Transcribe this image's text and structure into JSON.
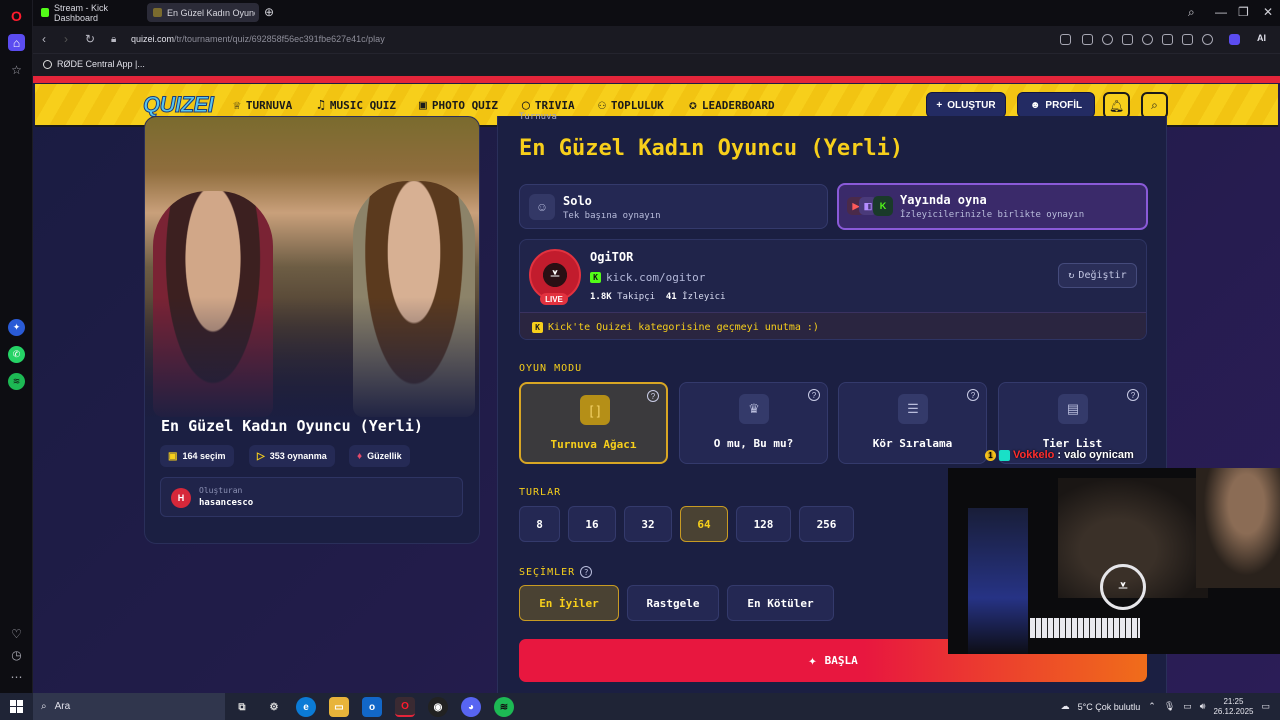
{
  "browser": {
    "tabs": [
      {
        "label": "Stream - Kick Dashboard",
        "favicon_color": "#53fc18"
      },
      {
        "label": "En Güzel Kadın Oyuncu (Y",
        "favicon_color": "#7a6b2e"
      }
    ],
    "url_host": "quizei.com",
    "url_path": "/tr/tournament/quiz/692858f56ec391fbe627e41c/play",
    "ai_label": "AI",
    "bookmark": "RØDE Central App |..."
  },
  "site": {
    "logo": "QUIZEI",
    "nav": [
      {
        "label": "TURNUVA",
        "icon": "trophy-icon"
      },
      {
        "label": "MUSIC QUIZ",
        "icon": "music-note-icon"
      },
      {
        "label": "PHOTO QUIZ",
        "icon": "camera-icon"
      },
      {
        "label": "TRIVIA",
        "icon": "chat-bubble-icon"
      },
      {
        "label": "TOPLULUK",
        "icon": "users-icon"
      },
      {
        "label": "LEADERBOARD",
        "icon": "medal-icon"
      }
    ],
    "create_btn": "OLUŞTUR",
    "profile_btn": "PROFİL",
    "accent": "#f7cf1b",
    "stripe_color": "#e4253a"
  },
  "quiz_card": {
    "title": "En Güzel Kadın Oyuncu (Yerli)",
    "choices": "164 seçim",
    "plays": "353 oynanma",
    "category": "Güzellik",
    "creator_label": "Oluşturan",
    "creator_initial": "H",
    "creator_name": "hasancesco"
  },
  "panel": {
    "breadcrumb": "Turnuva",
    "title": "En Güzel Kadın Oyuncu (Yerli)",
    "modes": [
      {
        "title": "Solo",
        "sub": "Tek başına oynayın"
      },
      {
        "title": "Yayında oyna",
        "sub": "İzleyicilerinizle birlikte oynayın"
      }
    ],
    "streamer": {
      "name": "OgiTOR",
      "link": "kick.com/ogitor",
      "followers": "1.8K",
      "followers_label": "Takipçi",
      "viewers": "41",
      "viewers_label": "İzleyici",
      "live": "LIVE",
      "change_btn": "Değiştir",
      "note": "Kick'te Quizei kategorisine geçmeyi unutma :)"
    },
    "game_mode_label": "OYUN MODU",
    "game_modes": [
      "Turnuva Ağacı",
      "O mu, Bu mu?",
      "Kör Sıralama",
      "Tier List"
    ],
    "rounds_label": "TURLAR",
    "rounds": [
      "8",
      "16",
      "32",
      "64",
      "128",
      "256"
    ],
    "selected_round": "64",
    "picks_label": "SEÇİMLER",
    "picks": [
      "En İyiler",
      "Rastgele",
      "En Kötüler"
    ],
    "start_btn": "BAŞLA"
  },
  "overlay": {
    "chat_user": "Vokkelo",
    "chat_msg": ": valo oynicam",
    "badge_num": "1"
  },
  "taskbar": {
    "search": "Ara",
    "weather": "5°C  Çok bulutlu",
    "time": "21:25",
    "date": "26.12.2025"
  }
}
